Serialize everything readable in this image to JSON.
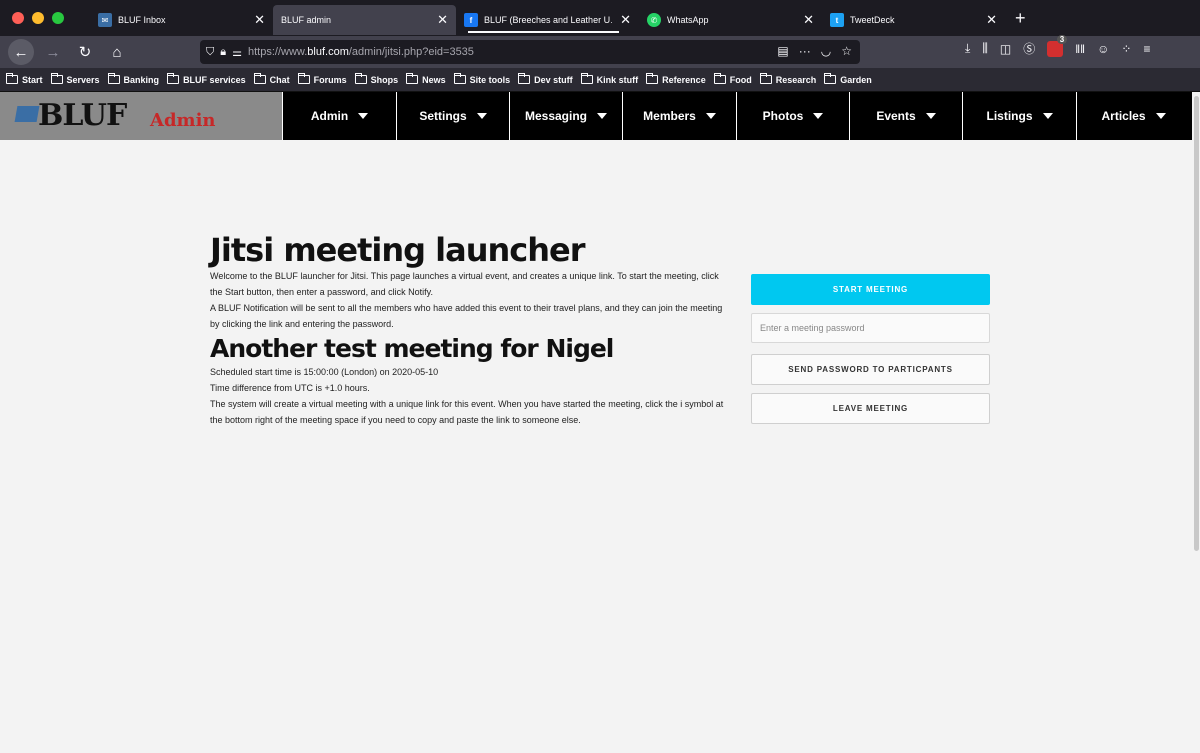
{
  "browser": {
    "tabs": [
      {
        "label": "BLUF Inbox",
        "icon": "bluf-mail-icon",
        "active": false
      },
      {
        "label": "BLUF admin",
        "icon": "",
        "active": true
      },
      {
        "label": "BLUF (Breeches and Leather U…",
        "icon": "facebook-icon",
        "active": false
      },
      {
        "label": "WhatsApp",
        "icon": "whatsapp-icon",
        "active": false
      },
      {
        "label": "TweetDeck",
        "icon": "tweetdeck-icon",
        "active": false
      }
    ],
    "url": {
      "prefix": "https://www.",
      "host": "bluf.com",
      "path": "/admin/jitsi.php?eid=3535"
    },
    "bookmarks": [
      "Start",
      "Servers",
      "Banking",
      "BLUF services",
      "Chat",
      "Forums",
      "Shops",
      "News",
      "Site tools",
      "Dev stuff",
      "Kink stuff",
      "Reference",
      "Food",
      "Research",
      "Garden"
    ],
    "extension_badge": "3",
    "colors": {
      "tabstrip": "#1c1b22",
      "toolbar": "#42414d"
    }
  },
  "site": {
    "logo_text": "BLUF",
    "logo_sub": "Admin",
    "menu": [
      "Admin",
      "Settings",
      "Messaging",
      "Members",
      "Photos",
      "Events",
      "Listings",
      "Articles"
    ]
  },
  "main": {
    "title": "Jitsi meeting launcher",
    "intro_1": "Welcome to the BLUF launcher for Jitsi. This page launches a virtual event, and creates a unique link. To start the meeting, click the Start button, then enter a password, and click Notify.",
    "intro_2": "A BLUF Notification will be sent to all the members who have added this event to their travel plans, and they can join the meeting by clicking the link and entering the password.",
    "event_title": "Another test meeting for Nigel",
    "schedule": "Scheduled start time is 15:00:00 (London) on 2020-05-10",
    "timediff": "Time difference from UTC is +1.0 hours.",
    "info": "The system will create a virtual meeting with a unique link for this event. When you have started the meeting, click the i symbol at the bottom right of the meeting space if you need to copy and paste the link to someone else."
  },
  "side": {
    "start_label": "START MEETING",
    "password_placeholder": "Enter a meeting password",
    "password_value": "",
    "send_label": "SEND PASSWORD TO PARTICPANTS",
    "leave_label": "LEAVE MEETING",
    "accent_color": "#00c8f0"
  }
}
